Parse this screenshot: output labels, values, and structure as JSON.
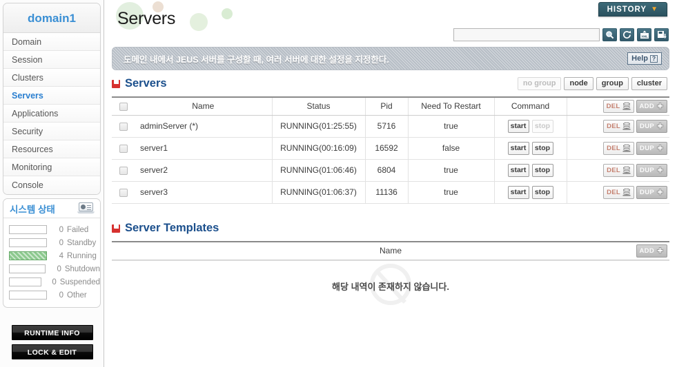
{
  "sidebar": {
    "domain_title": "domain1",
    "nav_items": [
      {
        "label": "Domain",
        "active": false
      },
      {
        "label": "Session",
        "active": false
      },
      {
        "label": "Clusters",
        "active": false
      },
      {
        "label": "Servers",
        "active": true
      },
      {
        "label": "Applications",
        "active": false
      },
      {
        "label": "Security",
        "active": false
      },
      {
        "label": "Resources",
        "active": false
      },
      {
        "label": "Monitoring",
        "active": false
      },
      {
        "label": "Console",
        "active": false
      }
    ],
    "status_panel": {
      "title": "시스템 상태",
      "icon": "monitor-chart-icon",
      "rows": [
        {
          "count": "0",
          "label": "Failed",
          "filled": false
        },
        {
          "count": "0",
          "label": "Standby",
          "filled": false
        },
        {
          "count": "4",
          "label": "Running",
          "filled": true
        },
        {
          "count": "0",
          "label": "Shutdown",
          "filled": false
        },
        {
          "count": "0",
          "label": "Suspended",
          "filled": false
        },
        {
          "count": "0",
          "label": "Other",
          "filled": false
        }
      ]
    },
    "buttons": [
      {
        "label": "RUNTIME INFO"
      },
      {
        "label": "LOCK & EDIT"
      }
    ]
  },
  "header": {
    "page_title": "Servers",
    "history_label": "HISTORY",
    "history_icon": "chevron-down-icon"
  },
  "search": {
    "value": "",
    "placeholder": "",
    "tools": [
      {
        "icon": "search-icon"
      },
      {
        "icon": "refresh-icon"
      },
      {
        "icon": "xml-export-icon"
      },
      {
        "icon": "save-export-icon"
      }
    ]
  },
  "description": {
    "text": "도메인 내에서 JEUS 서버를 구성할 때, 여러 서버에 대한 설정을 지정한다.",
    "help_label": "Help",
    "help_icon": "question-mark-icon"
  },
  "servers_section": {
    "title": "Servers",
    "group_buttons": [
      {
        "label": "no group",
        "disabled": true
      },
      {
        "label": "node",
        "disabled": false
      },
      {
        "label": "group",
        "disabled": false
      },
      {
        "label": "cluster",
        "disabled": false
      }
    ],
    "columns": [
      "Name",
      "Status",
      "Pid",
      "Need To Restart",
      "Command"
    ],
    "header_actions": [
      {
        "label": "DEL",
        "kind": "del",
        "icon": "stack-delete-icon"
      },
      {
        "label": "ADD",
        "kind": "add",
        "icon": "plus-icon"
      }
    ],
    "rows": [
      {
        "name": "adminServer (*)",
        "status": "RUNNING(01:25:55)",
        "pid": "5716",
        "need_to_restart": "true",
        "commands": [
          {
            "label": "start",
            "disabled": false
          },
          {
            "label": "stop",
            "disabled": true
          }
        ],
        "actions": [
          {
            "label": "DEL",
            "kind": "del",
            "icon": "stack-delete-icon"
          },
          {
            "label": "DUP",
            "kind": "dup",
            "icon": "plus-icon"
          }
        ]
      },
      {
        "name": "server1",
        "status": "RUNNING(00:16:09)",
        "pid": "16592",
        "need_to_restart": "false",
        "commands": [
          {
            "label": "start",
            "disabled": false
          },
          {
            "label": "stop",
            "disabled": false
          }
        ],
        "actions": [
          {
            "label": "DEL",
            "kind": "del",
            "icon": "stack-delete-icon"
          },
          {
            "label": "DUP",
            "kind": "dup",
            "icon": "plus-icon"
          }
        ]
      },
      {
        "name": "server2",
        "status": "RUNNING(01:06:46)",
        "pid": "6804",
        "need_to_restart": "true",
        "commands": [
          {
            "label": "start",
            "disabled": false
          },
          {
            "label": "stop",
            "disabled": false
          }
        ],
        "actions": [
          {
            "label": "DEL",
            "kind": "del",
            "icon": "stack-delete-icon"
          },
          {
            "label": "DUP",
            "kind": "dup",
            "icon": "plus-icon"
          }
        ]
      },
      {
        "name": "server3",
        "status": "RUNNING(01:06:37)",
        "pid": "11136",
        "need_to_restart": "true",
        "commands": [
          {
            "label": "start",
            "disabled": false
          },
          {
            "label": "stop",
            "disabled": false
          }
        ],
        "actions": [
          {
            "label": "DEL",
            "kind": "del",
            "icon": "stack-delete-icon"
          },
          {
            "label": "DUP",
            "kind": "dup",
            "icon": "plus-icon"
          }
        ]
      }
    ]
  },
  "templates_section": {
    "title": "Server Templates",
    "columns": [
      "Name"
    ],
    "header_actions": [
      {
        "label": "ADD",
        "kind": "add",
        "icon": "plus-icon"
      }
    ],
    "empty_message": "해당 내역이 존재하지 않습니다."
  },
  "colors": {
    "accent_blue": "#3a8fd4",
    "section_blue": "#1b4f8c",
    "marker_red": "#d6312f",
    "running_green": "#8cc98e",
    "history_teal": "#2b525f",
    "desc_gray": "#b7bec6"
  }
}
